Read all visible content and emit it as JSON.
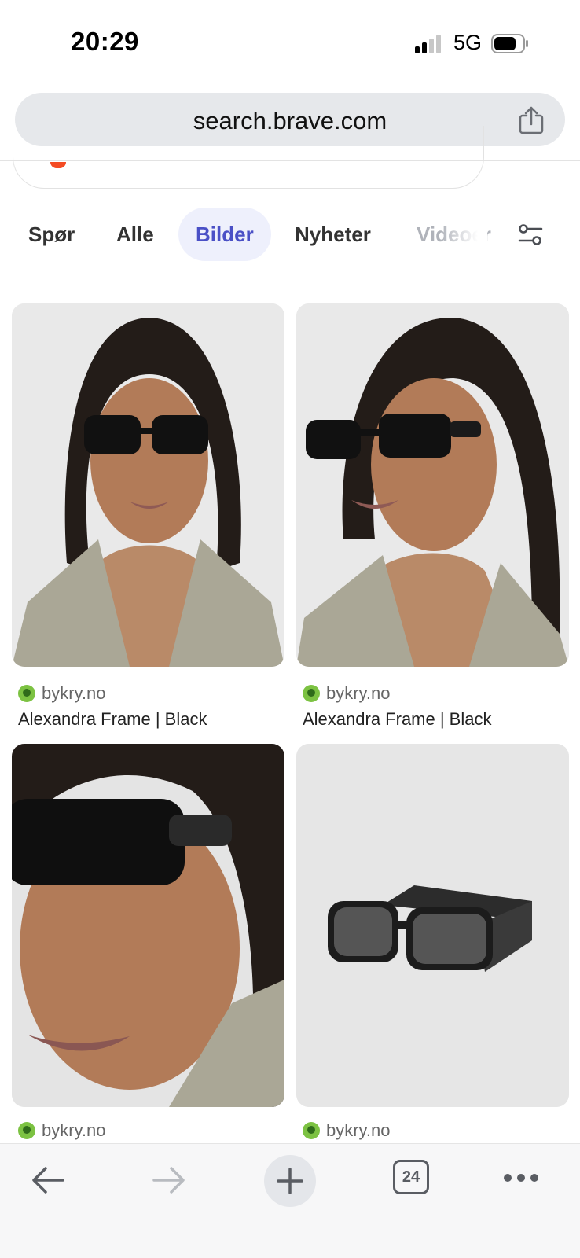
{
  "status": {
    "time": "20:29",
    "network": "5G"
  },
  "browser": {
    "url": "search.brave.com",
    "open_tabs_count": "24"
  },
  "tabs": [
    {
      "label": "Spør",
      "state": "normal"
    },
    {
      "label": "Alle",
      "state": "normal"
    },
    {
      "label": "Bilder",
      "state": "active"
    },
    {
      "label": "Nyheter",
      "state": "normal"
    },
    {
      "label": "Videoer",
      "state": "faded"
    }
  ],
  "results": [
    {
      "source": "bykry.no",
      "title": "Alexandra Frame | Black"
    },
    {
      "source": "bykry.no",
      "title": "Alexandra Frame | Black"
    },
    {
      "source": "bykry.no",
      "title": ""
    },
    {
      "source": "bykry.no",
      "title": ""
    }
  ],
  "colors": {
    "active_tab_text": "#4a50c6",
    "active_tab_bg": "#eef0fc",
    "favicon": "#7cc242",
    "url_bar_bg": "#e6e8eb"
  },
  "icons": {
    "share": "share-icon",
    "filter": "filter-icon",
    "back": "arrow-left-icon",
    "forward": "arrow-right-icon",
    "new_tab": "plus-icon",
    "tabs": "tab-switcher-icon",
    "menu": "more-dots-icon"
  }
}
